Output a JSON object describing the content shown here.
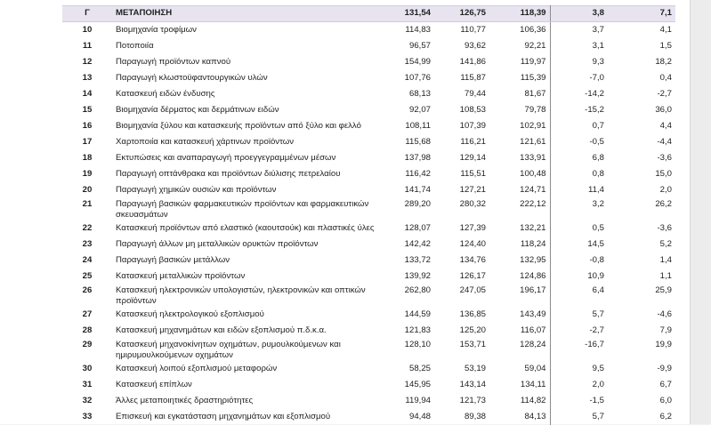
{
  "header": {
    "code": "Γ",
    "name": "ΜΕΤΑΠΟΙΗΣΗ",
    "v1": "131,54",
    "v2": "126,75",
    "v3": "118,39",
    "p1": "3,8",
    "p2": "7,1"
  },
  "rows": [
    {
      "code": "10",
      "name": "Βιομηχανία τροφίμων",
      "v1": "114,83",
      "v2": "110,77",
      "v3": "106,36",
      "p1": "3,7",
      "p2": "4,1"
    },
    {
      "code": "11",
      "name": "Ποτοποιία",
      "v1": "96,57",
      "v2": "93,62",
      "v3": "92,21",
      "p1": "3,1",
      "p2": "1,5"
    },
    {
      "code": "12",
      "name": "Παραγωγή προϊόντων καπνού",
      "v1": "154,99",
      "v2": "141,86",
      "v3": "119,97",
      "p1": "9,3",
      "p2": "18,2"
    },
    {
      "code": "13",
      "name": "Παραγωγή κλωστοϋφαντουργικών υλών",
      "v1": "107,76",
      "v2": "115,87",
      "v3": "115,39",
      "p1": "-7,0",
      "p2": "0,4"
    },
    {
      "code": "14",
      "name": "Κατασκευή ειδών ένδυσης",
      "v1": "68,13",
      "v2": "79,44",
      "v3": "81,67",
      "p1": "-14,2",
      "p2": "-2,7"
    },
    {
      "code": "15",
      "name": "Βιομηχανία δέρματος και δερμάτινων ειδών",
      "v1": "92,07",
      "v2": "108,53",
      "v3": "79,78",
      "p1": "-15,2",
      "p2": "36,0"
    },
    {
      "code": "16",
      "name": "Βιομηχανία ξύλου και κατασκευής προϊόντων από ξύλο και φελλό",
      "v1": "108,11",
      "v2": "107,39",
      "v3": "102,91",
      "p1": "0,7",
      "p2": "4,4"
    },
    {
      "code": "17",
      "name": "Χαρτοποιία και κατασκευή χάρτινων προϊόντων",
      "v1": "115,68",
      "v2": "116,21",
      "v3": "121,61",
      "p1": "-0,5",
      "p2": "-4,4"
    },
    {
      "code": "18",
      "name": "Εκτυπώσεις και αναπαραγωγή προεγγεγραμμένων μέσων",
      "v1": "137,98",
      "v2": "129,14",
      "v3": "133,91",
      "p1": "6,8",
      "p2": "-3,6"
    },
    {
      "code": "19",
      "name": "Παραγωγή οπτάνθρακα και προϊόντων διύλισης πετρελαίου",
      "v1": "116,42",
      "v2": "115,51",
      "v3": "100,48",
      "p1": "0,8",
      "p2": "15,0"
    },
    {
      "code": "20",
      "name": "Παραγωγή χημικών ουσιών και προϊόντων",
      "v1": "141,74",
      "v2": "127,21",
      "v3": "124,71",
      "p1": "11,4",
      "p2": "2,0"
    },
    {
      "code": "21",
      "name": "Παραγωγή βασικών φαρμακευτικών προϊόντων και φαρμακευτικών σκευασμάτων",
      "v1": "289,20",
      "v2": "280,32",
      "v3": "222,12",
      "p1": "3,2",
      "p2": "26,2",
      "tall": true
    },
    {
      "code": "22",
      "name": "Κατασκευή προϊόντων από ελαστικό (καουτσούκ) και πλαστικές ύλες",
      "v1": "128,07",
      "v2": "127,39",
      "v3": "132,21",
      "p1": "0,5",
      "p2": "-3,6"
    },
    {
      "code": "23",
      "name": "Παραγωγή άλλων μη μεταλλικών ορυκτών προϊόντων",
      "v1": "142,42",
      "v2": "124,40",
      "v3": "118,24",
      "p1": "14,5",
      "p2": "5,2"
    },
    {
      "code": "24",
      "name": "Παραγωγή βασικών μετάλλων",
      "v1": "133,72",
      "v2": "134,76",
      "v3": "132,95",
      "p1": "-0,8",
      "p2": "1,4"
    },
    {
      "code": "25",
      "name": "Κατασκευή μεταλλικών προϊόντων",
      "v1": "139,92",
      "v2": "126,17",
      "v3": "124,86",
      "p1": "10,9",
      "p2": "1,1"
    },
    {
      "code": "26",
      "name": "Κατασκευή ηλεκτρονικών υπολογιστών, ηλεκτρονικών και οπτικών προϊόντων",
      "v1": "262,80",
      "v2": "247,05",
      "v3": "196,17",
      "p1": "6,4",
      "p2": "25,9",
      "tall": true
    },
    {
      "code": "27",
      "name": "Κατασκευή ηλεκτρολογικού εξοπλισμού",
      "v1": "144,59",
      "v2": "136,85",
      "v3": "143,49",
      "p1": "5,7",
      "p2": "-4,6"
    },
    {
      "code": "28",
      "name": "Κατασκευή μηχανημάτων και ειδών εξοπλισμού π.δ.κ.α.",
      "v1": "121,83",
      "v2": "125,20",
      "v3": "116,07",
      "p1": "-2,7",
      "p2": "7,9"
    },
    {
      "code": "29",
      "name": "Κατασκευή μηχανοκίνητων οχημάτων, ρυμουλκούμενων και ημιρυμουλκούμενων οχημάτων",
      "v1": "128,10",
      "v2": "153,71",
      "v3": "128,24",
      "p1": "-16,7",
      "p2": "19,9",
      "tall": true
    },
    {
      "code": "30",
      "name": "Κατασκευή λοιπού εξοπλισμού μεταφορών",
      "v1": "58,25",
      "v2": "53,19",
      "v3": "59,04",
      "p1": "9,5",
      "p2": "-9,9"
    },
    {
      "code": "31",
      "name": "Κατασκευή επίπλων",
      "v1": "145,95",
      "v2": "143,14",
      "v3": "134,11",
      "p1": "2,0",
      "p2": "6,7"
    },
    {
      "code": "32",
      "name": "Άλλες μεταποιητικές δραστηριότητες",
      "v1": "119,94",
      "v2": "121,73",
      "v3": "114,82",
      "p1": "-1,5",
      "p2": "6,0"
    },
    {
      "code": "33",
      "name": "Επισκευή και εγκατάσταση μηχανημάτων και εξοπλισμού",
      "v1": "94,48",
      "v2": "89,38",
      "v3": "84,13",
      "p1": "5,7",
      "p2": "6,2"
    }
  ]
}
